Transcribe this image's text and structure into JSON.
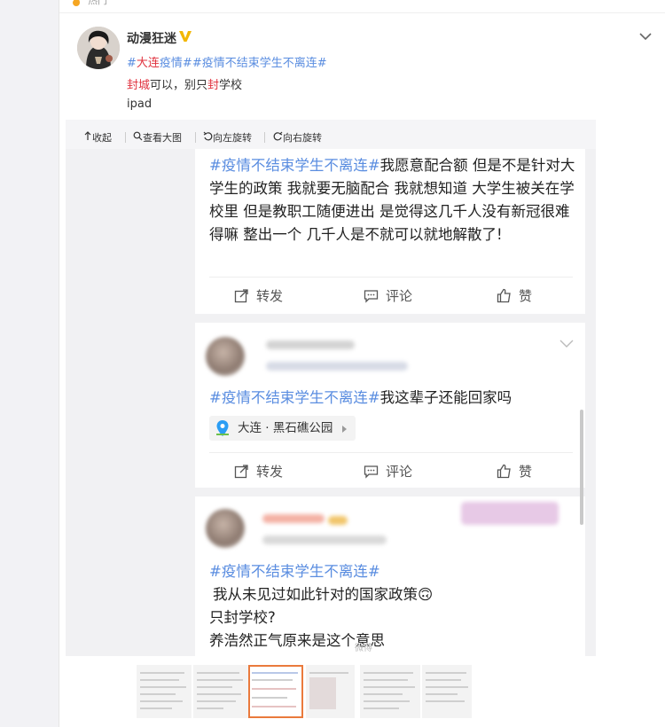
{
  "top": {
    "label": "热门"
  },
  "post": {
    "username": "动漫狂迷",
    "tag_prefix": "#",
    "tag_red": "大连",
    "tag_rest": "疫情##疫情不结束学生不离连#",
    "line2_red1": "封城",
    "line2_mid": "可以，别只",
    "line2_red2": "封",
    "line2_end": "学校",
    "source": "ipad"
  },
  "toolbar": {
    "collapse": "收起",
    "view_large": "查看大图",
    "rotate_left": "向左旋转",
    "rotate_right": "向右旋转"
  },
  "image_posts": [
    {
      "hashtag": "#疫情不结束学生不离连#",
      "text": "我愿意配合额 但是不是针对大学生的政策 我就要无脑配合 我就想知道 大学生被关在学校里 但是教职工随便进出 是觉得这几千人没有新冠很难得嘛 整出一个 几千人是不就可以就地解散了!",
      "actions": [
        "转发",
        "评论",
        "赞"
      ]
    },
    {
      "hashtag": "#疫情不结束学生不离连#",
      "text": "我这辈子还能回家吗",
      "location": "大连 · 黑石礁公园",
      "actions": [
        "转发",
        "评论",
        "赞"
      ]
    },
    {
      "hashtag": "#疫情不结束学生不离连#",
      "lines": [
        "我从未见过如此针对的国家政策🙃",
        "只封学校?",
        "养浩然正气原来是这个意思"
      ]
    }
  ],
  "watermark": "微博",
  "colors": {
    "link": "#5a8de0",
    "red": "#e0323e",
    "thumb_selected": "#ea7a3c"
  }
}
